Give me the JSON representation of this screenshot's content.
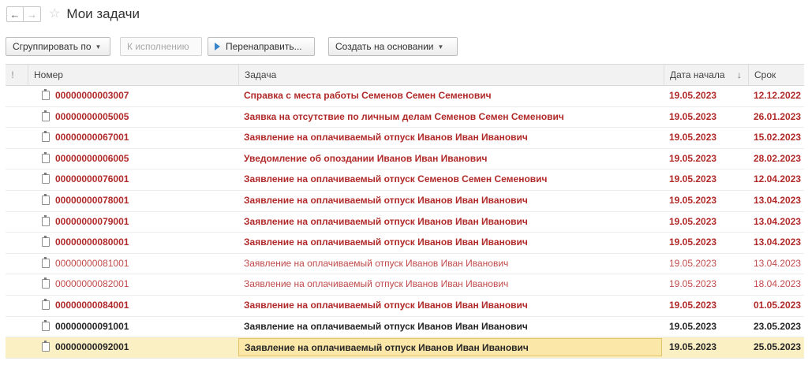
{
  "nav": {
    "back_icon": "arrow-left-icon",
    "forward_icon": "arrow-right-icon",
    "back": "←",
    "forward": "→"
  },
  "page": {
    "title": "Мои задачи",
    "favorite": "☆"
  },
  "toolbar": {
    "group_by": "Сгруппировать по",
    "execute": "К исполнению",
    "redirect": "Перенаправить...",
    "create_based": "Создать на основании"
  },
  "table": {
    "columns": {
      "flag": "!",
      "number": "Номер",
      "task": "Задача",
      "start_date": "Дата начала",
      "due": "Срок"
    },
    "sort_indicator": "↓",
    "rows": [
      {
        "number": "00000000003007",
        "task": "Справка с места работы Семенов Семен Семенович",
        "start": "19.05.2023",
        "due": "12.12.2022",
        "style": "red bold"
      },
      {
        "number": "00000000005005",
        "task": "Заявка на отсутствие по личным делам Семенов Семен Семенович",
        "start": "19.05.2023",
        "due": "26.01.2023",
        "style": "red bold"
      },
      {
        "number": "00000000067001",
        "task": "Заявление на оплачиваемый отпуск Иванов Иван Иванович",
        "start": "19.05.2023",
        "due": "15.02.2023",
        "style": "red bold"
      },
      {
        "number": "00000000006005",
        "task": "Уведомление об опоздании Иванов Иван Иванович",
        "start": "19.05.2023",
        "due": "28.02.2023",
        "style": "red bold"
      },
      {
        "number": "00000000076001",
        "task": "Заявление на оплачиваемый отпуск Семенов Семен Семенович",
        "start": "19.05.2023",
        "due": "12.04.2023",
        "style": "red bold"
      },
      {
        "number": "00000000078001",
        "task": "Заявление на оплачиваемый отпуск Иванов Иван Иванович",
        "start": "19.05.2023",
        "due": "13.04.2023",
        "style": "red bold"
      },
      {
        "number": "00000000079001",
        "task": "Заявление на оплачиваемый отпуск Иванов Иван Иванович",
        "start": "19.05.2023",
        "due": "13.04.2023",
        "style": "red bold"
      },
      {
        "number": "00000000080001",
        "task": "Заявление на оплачиваемый отпуск Иванов Иван Иванович",
        "start": "19.05.2023",
        "due": "13.04.2023",
        "style": "red bold"
      },
      {
        "number": "00000000081001",
        "task": "Заявление на оплачиваемый отпуск Иванов Иван Иванович",
        "start": "19.05.2023",
        "due": "13.04.2023",
        "style": "redlight"
      },
      {
        "number": "00000000082001",
        "task": "Заявление на оплачиваемый отпуск Иванов Иван Иванович",
        "start": "19.05.2023",
        "due": "18.04.2023",
        "style": "redlight"
      },
      {
        "number": "00000000084001",
        "task": "Заявление на оплачиваемый отпуск Иванов Иван Иванович",
        "start": "19.05.2023",
        "due": "01.05.2023",
        "style": "red bold"
      },
      {
        "number": "00000000091001",
        "task": "Заявление на оплачиваемый отпуск Иванов Иван Иванович",
        "start": "19.05.2023",
        "due": "23.05.2023",
        "style": "dark bold"
      },
      {
        "number": "00000000092001",
        "task": "Заявление на оплачиваемый отпуск Иванов Иван Иванович",
        "start": "19.05.2023",
        "due": "25.05.2023",
        "style": "dark bold sel"
      }
    ]
  },
  "colors": {
    "overdue": "#b12a2a",
    "normal": "#262626",
    "selection": "#fbefc4"
  }
}
